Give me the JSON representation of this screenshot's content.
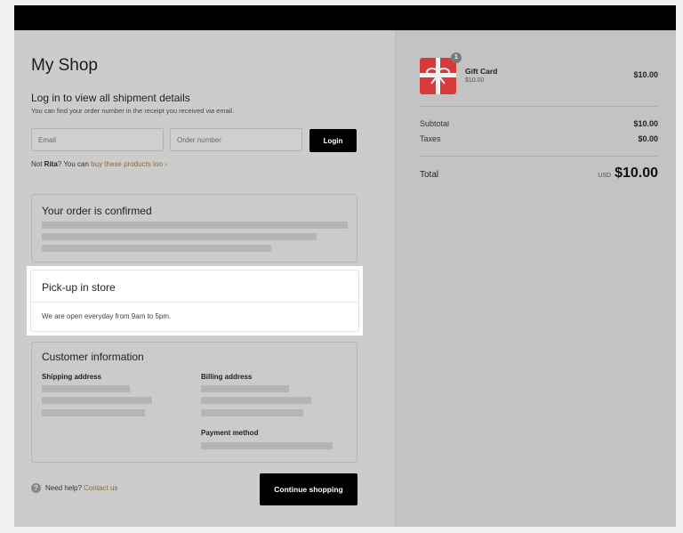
{
  "shop": {
    "title": "My Shop",
    "login_heading": "Log in to view all shipment details",
    "login_sub": "You can find your order number in the receipt you received via email.",
    "email_placeholder": "Email",
    "order_placeholder": "Order number",
    "login_label": "Login",
    "not_user_prefix": "Not ",
    "not_user_name": "Rita",
    "not_user_suffix": "? You can ",
    "buy_link": "buy these products too ›"
  },
  "confirmed": {
    "title": "Your order is confirmed"
  },
  "pickup": {
    "title": "Pick-up in store",
    "text": "We are open everyday from 9am to 5pm."
  },
  "customer": {
    "title": "Customer information",
    "shipping_label": "Shipping address",
    "billing_label": "Billing address",
    "payment_label": "Payment method"
  },
  "footer": {
    "help_icon": "?",
    "need_help": "Need help?",
    "contact": "Contact us",
    "continue_label": "Continue shopping"
  },
  "summary": {
    "item": {
      "name": "Gift Card",
      "sub": "$10.00",
      "price": "$10.00",
      "qty": "1",
      "icon": "gift-card-thumbnail",
      "color": "#d83a3a"
    },
    "subtotal_label": "Subtotal",
    "subtotal_value": "$10.00",
    "taxes_label": "Taxes",
    "taxes_value": "$0.00",
    "total_label": "Total",
    "currency": "USD",
    "total_value": "$10.00"
  },
  "colors": {
    "accent_link": "#8a6a3a",
    "button": "#000000"
  }
}
